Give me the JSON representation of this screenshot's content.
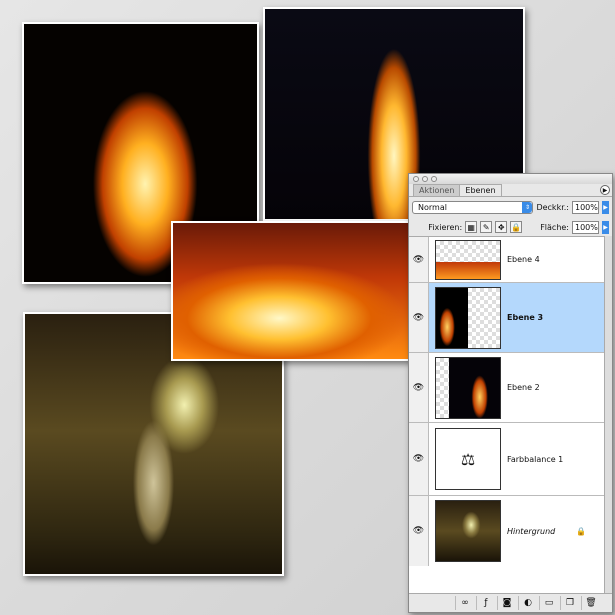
{
  "panel": {
    "tabs": [
      "Aktionen",
      "Ebenen"
    ],
    "blend_mode": "Normal",
    "opacity_label": "Deckkr.:",
    "opacity": "100%",
    "lock_label": "Fixieren:",
    "fill_label": "Fläche:",
    "fill": "100%",
    "layers": [
      {
        "name": "Ebene 4"
      },
      {
        "name": "Ebene 3"
      },
      {
        "name": "Ebene 2"
      },
      {
        "name": "Farbbalance 1"
      },
      {
        "name": "Hintergrund"
      }
    ]
  },
  "colors": {
    "selected": "#b4d8fc",
    "accent": "#3a8ce8"
  }
}
